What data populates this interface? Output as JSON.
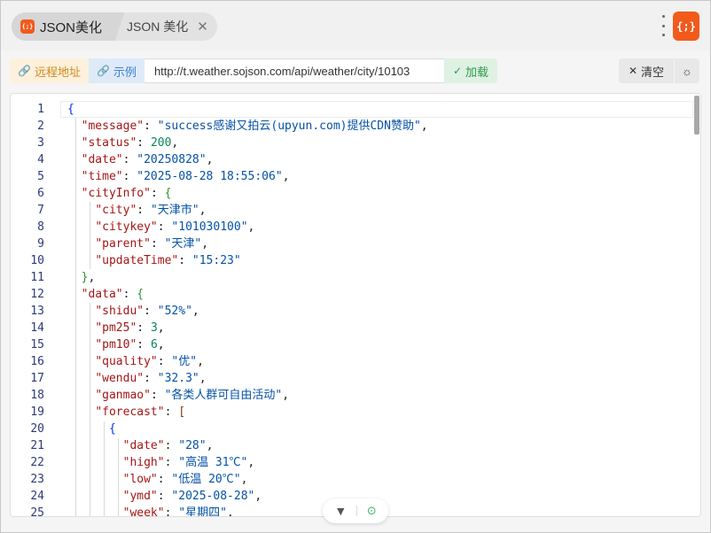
{
  "tabs": [
    {
      "icon": "json-app-icon",
      "label": "JSON美化",
      "active": true
    },
    {
      "label": "JSON 美化",
      "close": "✕"
    }
  ],
  "logo_text": "{;}",
  "logo_color": "#f25a1c",
  "toolbar": {
    "remote_label": "远程地址",
    "example_label": "示例",
    "url_value": "http://t.weather.sojson.com/api/weather/city/10103",
    "load_label": "加载",
    "clear_label": "清空"
  },
  "editor_lines": [
    "{",
    "  \"message\": \"success感谢又拍云(upyun.com)提供CDN赞助\",",
    "  \"status\": 200,",
    "  \"date\": \"20250828\",",
    "  \"time\": \"2025-08-28 18:55:06\",",
    "  \"cityInfo\": {",
    "    \"city\": \"天津市\",",
    "    \"citykey\": \"101030100\",",
    "    \"parent\": \"天津\",",
    "    \"updateTime\": \"15:23\"",
    "  },",
    "  \"data\": {",
    "    \"shidu\": \"52%\",",
    "    \"pm25\": 3,",
    "    \"pm10\": 6,",
    "    \"quality\": \"优\",",
    "    \"wendu\": \"32.3\",",
    "    \"ganmao\": \"各类人群可自由活动\",",
    "    \"forecast\": [",
    "      {",
    "        \"date\": \"28\",",
    "        \"high\": \"高温 31℃\",",
    "        \"low\": \"低温 20℃\",",
    "        \"ymd\": \"2025-08-28\",",
    "        \"week\": \"星期四\","
  ],
  "first_line_number": 1
}
